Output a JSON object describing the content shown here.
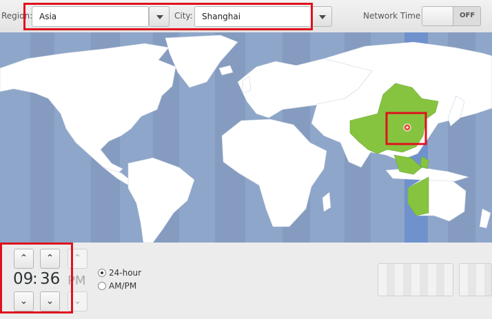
{
  "toolbar": {
    "region_label": "Region:",
    "region_value": "Asia",
    "city_label": "City:",
    "city_value": "Shanghai",
    "network_time_label": "Network Time",
    "network_time_state": "OFF"
  },
  "map": {
    "selected_city": "Shanghai",
    "highlight_color": "#86c440",
    "timezone_band_color": "#6f92cc",
    "ocean_color": "#8ea6c9",
    "land_color": "#ffffff"
  },
  "clock": {
    "hours": "09",
    "separator": ":",
    "minutes": "36",
    "period": "PM",
    "up_icon": "chevron-up-icon",
    "down_icon": "chevron-down-icon"
  },
  "format": {
    "option_24": "24-hour",
    "option_ampm": "AM/PM",
    "selected": "24-hour"
  },
  "annotations": {
    "highlight_color": "#e0101d"
  }
}
